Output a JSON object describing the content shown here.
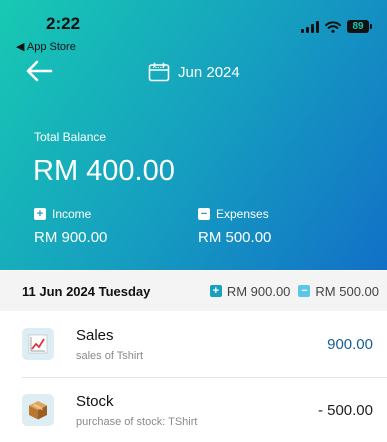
{
  "status_bar": {
    "time": "2:22",
    "back_label": "◀ App Store",
    "battery": "89"
  },
  "header": {
    "month": "Jun 2024"
  },
  "balance": {
    "total_label": "Total Balance",
    "total_amount": "RM 400.00",
    "income_label": "Income",
    "income_amount": "RM 900.00",
    "expenses_label": "Expenses",
    "expenses_amount": "RM 500.00"
  },
  "day_group": {
    "date": "11 Jun 2024 Tuesday",
    "income_total": "RM 900.00",
    "expense_total": "RM 500.00"
  },
  "transactions": [
    {
      "title": "Sales",
      "subtitle": "sales of Tshirt",
      "amount": "900.00",
      "icon": "chart-icon"
    },
    {
      "title": "Stock",
      "subtitle": "purchase of stock: TShirt",
      "amount": "- 500.00",
      "icon": "package-icon"
    }
  ],
  "colors": {
    "accent": "#159ec0",
    "income_text": "#1b5e96"
  }
}
